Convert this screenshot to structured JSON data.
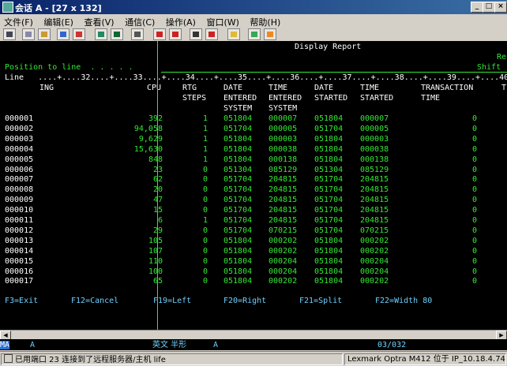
{
  "window": {
    "title": "会话 A - [27 x 132]",
    "min": "_",
    "max": "□",
    "close": "×"
  },
  "menu": [
    "文件(F)",
    "编辑(E)",
    "查看(V)",
    "通信(C)",
    "操作(A)",
    "窗口(W)",
    "帮助(H)"
  ],
  "toolbar_icons": [
    "print-icon",
    "copy-icon",
    "paste-icon",
    "send-icon",
    "receive-icon",
    "display-icon",
    "keyboard-icon",
    "macro-record-icon",
    "macro-play-icon",
    "macro-stop-icon",
    "macro-icon",
    "clipboard-icon",
    "transfer-icon",
    "map-icon",
    "help-icon"
  ],
  "screen": {
    "report_title": "Display Report",
    "right_top": "Re",
    "position_label": "Position to line  . . . . .",
    "shift_label": "Shift",
    "ruler": "Line   ....+....32....+....33....+....34....+....35....+....36....+....37....+....38....+....39....+....40..",
    "headers": {
      "h_ing": "ING",
      "h_cpu": "CPU",
      "h_rtg": [
        "RTG",
        "STEPS"
      ],
      "h_date_entered": [
        "DATE",
        "ENTERED",
        "SYSTEM"
      ],
      "h_time_entered": [
        "TIME",
        "ENTERED",
        "SYSTEM"
      ],
      "h_date_started": [
        "DATE",
        "STARTED"
      ],
      "h_time_started": [
        "TIME",
        "STARTED"
      ],
      "h_transaction": [
        "TRANSACTION",
        "TIME"
      ],
      "h_t": "T"
    },
    "rows": [
      {
        "line": "000001",
        "cpu": "392",
        "rtg": "1",
        "date_entered": "051804",
        "time_entered": "000007",
        "date_started": "051804",
        "time_started": "000007",
        "trans": "0"
      },
      {
        "line": "000002",
        "cpu": "94,058",
        "rtg": "1",
        "date_entered": "051704",
        "time_entered": "000005",
        "date_started": "051704",
        "time_started": "000005",
        "trans": "0"
      },
      {
        "line": "000003",
        "cpu": "9,629",
        "rtg": "1",
        "date_entered": "051804",
        "time_entered": "000003",
        "date_started": "051804",
        "time_started": "000003",
        "trans": "0"
      },
      {
        "line": "000004",
        "cpu": "15,630",
        "rtg": "1",
        "date_entered": "051804",
        "time_entered": "000038",
        "date_started": "051804",
        "time_started": "000038",
        "trans": "0"
      },
      {
        "line": "000005",
        "cpu": "848",
        "rtg": "1",
        "date_entered": "051804",
        "time_entered": "000138",
        "date_started": "051804",
        "time_started": "000138",
        "trans": "0"
      },
      {
        "line": "000006",
        "cpu": "23",
        "rtg": "0",
        "date_entered": "051304",
        "time_entered": "085129",
        "date_started": "051304",
        "time_started": "085129",
        "trans": "0"
      },
      {
        "line": "000007",
        "cpu": "62",
        "rtg": "0",
        "date_entered": "051704",
        "time_entered": "204815",
        "date_started": "051704",
        "time_started": "204815",
        "trans": "0"
      },
      {
        "line": "000008",
        "cpu": "20",
        "rtg": "0",
        "date_entered": "051704",
        "time_entered": "204815",
        "date_started": "051704",
        "time_started": "204815",
        "trans": "0"
      },
      {
        "line": "000009",
        "cpu": "47",
        "rtg": "0",
        "date_entered": "051704",
        "time_entered": "204815",
        "date_started": "051704",
        "time_started": "204815",
        "trans": "0"
      },
      {
        "line": "000010",
        "cpu": "15",
        "rtg": "0",
        "date_entered": "051704",
        "time_entered": "204815",
        "date_started": "051704",
        "time_started": "204815",
        "trans": "0"
      },
      {
        "line": "000011",
        "cpu": "6",
        "rtg": "1",
        "date_entered": "051704",
        "time_entered": "204815",
        "date_started": "051704",
        "time_started": "204815",
        "trans": "0"
      },
      {
        "line": "000012",
        "cpu": "29",
        "rtg": "0",
        "date_entered": "051704",
        "time_entered": "070215",
        "date_started": "051704",
        "time_started": "070215",
        "trans": "0"
      },
      {
        "line": "000013",
        "cpu": "105",
        "rtg": "0",
        "date_entered": "051804",
        "time_entered": "000202",
        "date_started": "051804",
        "time_started": "000202",
        "trans": "0"
      },
      {
        "line": "000014",
        "cpu": "107",
        "rtg": "0",
        "date_entered": "051804",
        "time_entered": "000202",
        "date_started": "051804",
        "time_started": "000202",
        "trans": "0"
      },
      {
        "line": "000015",
        "cpu": "110",
        "rtg": "0",
        "date_entered": "051804",
        "time_entered": "000204",
        "date_started": "051804",
        "time_started": "000204",
        "trans": "0"
      },
      {
        "line": "000016",
        "cpu": "100",
        "rtg": "0",
        "date_entered": "051804",
        "time_entered": "000204",
        "date_started": "051804",
        "time_started": "000204",
        "trans": "0"
      },
      {
        "line": "000017",
        "cpu": "65",
        "rtg": "0",
        "date_entered": "051804",
        "time_entered": "000202",
        "date_started": "051804",
        "time_started": "000202",
        "trans": "0"
      }
    ],
    "fkeys": [
      "F3=Exit",
      "F12=Cancel",
      "F19=Left",
      "F20=Right",
      "F21=Split",
      "F22=Width 80"
    ]
  },
  "status_line": {
    "ma": "MA",
    "a1": "A",
    "ime": "英文 半形",
    "a2": "A",
    "cursor": "03/032"
  },
  "statusbar": {
    "connection": "已用端口 23 连接到了远程服务器/主机 life",
    "printer": "Lexmark Optra M412 位于 IP_10.18.4.74"
  },
  "colors": {
    "screen_bg": "#000000",
    "field_green": "#34e834",
    "text_white": "#ffffff",
    "status_cyan": "#6fd0ff",
    "title_blue": "#0a246a"
  }
}
